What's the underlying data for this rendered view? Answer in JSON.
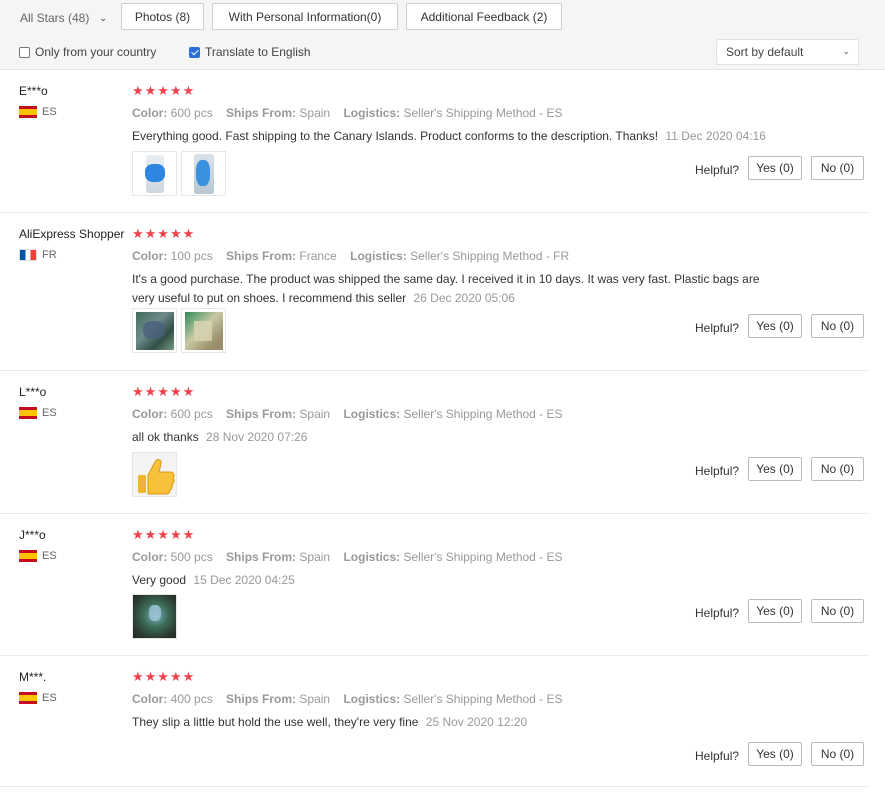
{
  "filters": {
    "all_stars": "All Stars (48)",
    "photos": "Photos (8)",
    "personal_info": "With Personal Information(0)",
    "additional_feedback": "Additional Feedback (2)",
    "only_country": "Only from your country",
    "only_country_checked": false,
    "translate": "Translate to English",
    "translate_checked": true,
    "sort": "Sort by default"
  },
  "labels": {
    "color": "Color:",
    "ships_from": "Ships From:",
    "logistics": "Logistics:",
    "helpful": "Helpful?"
  },
  "reviews": [
    {
      "user": "E***o",
      "country": "ES",
      "stars": 5,
      "stars_text": "★★★★★",
      "color": "600 pcs",
      "ships_from": "Spain",
      "logistics": "Seller's Shipping Method - ES",
      "text": "Everything good. Fast shipping to the Canary Islands. Product conforms to the description. Thanks!",
      "date": "11 Dec 2020 04:16",
      "yes": "Yes (0)",
      "no": "No (0)"
    },
    {
      "user": "AliExpress Shopper",
      "country": "FR",
      "stars": 5,
      "stars_text": "★★★★★",
      "color": "100 pcs",
      "ships_from": "France",
      "logistics": "Seller's Shipping Method - FR",
      "text": "It's a good purchase. The product was shipped the same day. I received it in 10 days. It was very fast. Plastic bags are very useful to put on shoes. I recommend this seller",
      "date": "26 Dec 2020 05:06",
      "yes": "Yes (0)",
      "no": "No (0)"
    },
    {
      "user": "L***o",
      "country": "ES",
      "stars": 5,
      "stars_text": "★★★★★",
      "color": "600 pcs",
      "ships_from": "Spain",
      "logistics": "Seller's Shipping Method - ES",
      "text": "all ok thanks",
      "date": "28 Nov 2020 07:26",
      "yes": "Yes (0)",
      "no": "No (0)"
    },
    {
      "user": "J***o",
      "country": "ES",
      "stars": 5,
      "stars_text": "★★★★★",
      "color": "500 pcs",
      "ships_from": "Spain",
      "logistics": "Seller's Shipping Method - ES",
      "text": "Very good",
      "date": "15 Dec 2020 04:25",
      "yes": "Yes (0)",
      "no": "No (0)"
    },
    {
      "user": "M***.",
      "country": "ES",
      "stars": 5,
      "stars_text": "★★★★★",
      "color": "400 pcs",
      "ships_from": "Spain",
      "logistics": "Seller's Shipping Method - ES",
      "text": "They slip a little but hold the use well, they're very fine",
      "date": "25 Nov 2020 12:20",
      "yes": "Yes (0)",
      "no": "No (0)"
    }
  ],
  "colors": {
    "star": "#f0424c",
    "checkbox_checked": "#2b6fd6"
  }
}
